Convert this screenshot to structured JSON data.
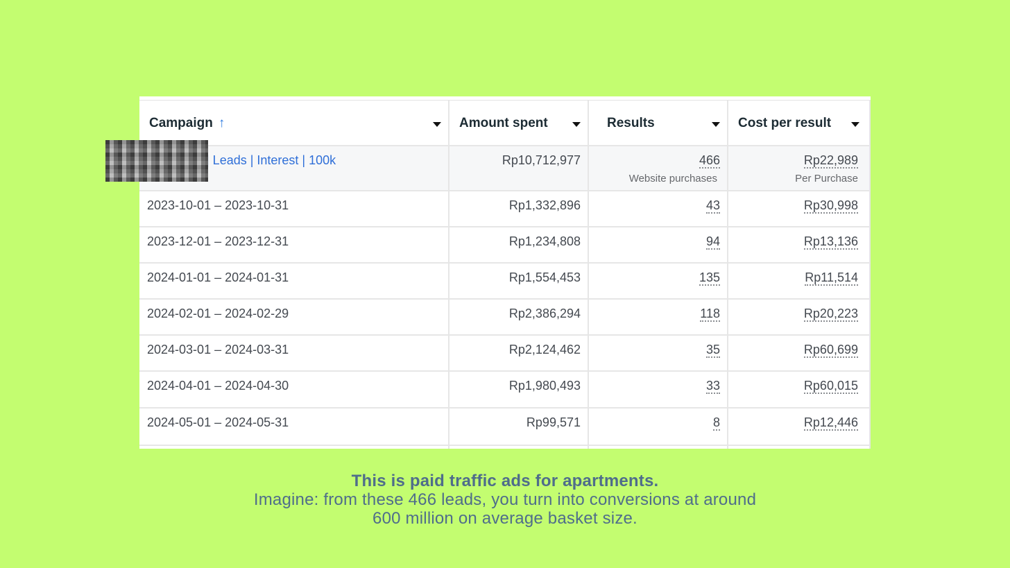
{
  "table": {
    "headers": {
      "campaign": "Campaign",
      "sort_icon": "↑",
      "amount_spent": "Amount spent",
      "results": "Results",
      "cost_per_result": "Cost per result"
    },
    "total": {
      "campaign_link": "| Leads | Interest | 100k",
      "amount": "Rp10,712,977",
      "results": "466",
      "results_sub": "Website purchases",
      "cost": "Rp22,989",
      "cost_sub": "Per Purchase"
    },
    "rows": [
      {
        "date": "2023-10-01 – 2023-10-31",
        "amount": "Rp1,332,896",
        "results": "43",
        "cost": "Rp30,998"
      },
      {
        "date": "2023-12-01 – 2023-12-31",
        "amount": "Rp1,234,808",
        "results": "94",
        "cost": "Rp13,136"
      },
      {
        "date": "2024-01-01 – 2024-01-31",
        "amount": "Rp1,554,453",
        "results": "135",
        "cost": "Rp11,514"
      },
      {
        "date": "2024-02-01 – 2024-02-29",
        "amount": "Rp2,386,294",
        "results": "118",
        "cost": "Rp20,223"
      },
      {
        "date": "2024-03-01 – 2024-03-31",
        "amount": "Rp2,124,462",
        "results": "35",
        "cost": "Rp60,699"
      },
      {
        "date": "2024-04-01 – 2024-04-30",
        "amount": "Rp1,980,493",
        "results": "33",
        "cost": "Rp60,015"
      },
      {
        "date": "2024-05-01 – 2024-05-31",
        "amount": "Rp99,571",
        "results": "8",
        "cost": "Rp12,446"
      }
    ]
  },
  "caption": {
    "heading": "This is paid traffic ads for apartments.",
    "line1": "Imagine: from these 466 leads, you turn into conversions at around",
    "line2": "600 million on average basket size."
  },
  "colors": {
    "background": "#c3fd70",
    "link": "#2f6fd8",
    "caption": "#4f6d8b"
  }
}
